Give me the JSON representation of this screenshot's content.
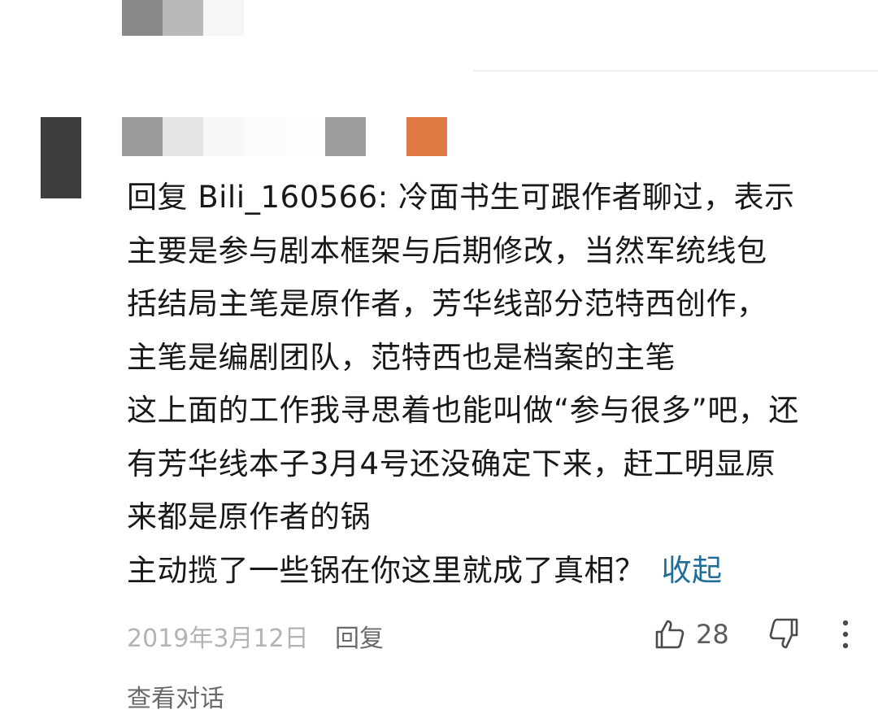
{
  "comment": {
    "reply_prefix": "回复 Bili_160566: ",
    "lines": [
      "冷面书生可跟作者聊过，表示",
      "主要是参与剧本框架与后期修改，当然军统线包",
      "括结局主笔是原作者，芳华线部分范特西创作，",
      "主笔是编剧团队，范特西也是档案的主笔",
      "这上面的工作我寻思着也能叫做“参与很多”吧，还",
      "有芳华线本子3月4号还没确定下来，赶工明显原",
      "来都是原作者的锅",
      "主动揽了一些锅在你这里就成了真相？"
    ],
    "collapse_label": "收起",
    "date": "2019年3月12日",
    "reply_label": "回复",
    "like_count": "28",
    "view_thread_label": "查看对话"
  },
  "icons": {
    "like": "thumbs-up-icon",
    "dislike": "thumbs-down-icon",
    "more": "more-vertical-icon"
  },
  "colors": {
    "link": "#1f6e9a",
    "level_badge": "#e07a45",
    "meta_text": "#b3b3b3"
  }
}
